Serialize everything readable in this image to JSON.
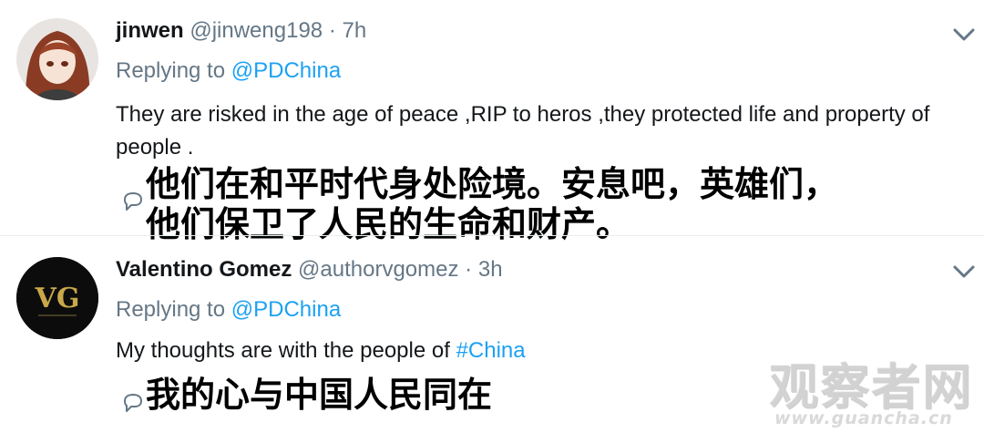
{
  "tweets": [
    {
      "name": "jinwen",
      "handle": "@jinweng198",
      "dot": "·",
      "time": "7h",
      "replying_label": "Replying to",
      "replying_to": "@PDChina",
      "text": "They are risked in the age of peace ,RIP to heros ,they protected life and property of people .",
      "caption_lines": [
        "他们在和平时代身处险境。安息吧，英雄们，",
        "他们保卫了人民的生命和财产。"
      ]
    },
    {
      "name": "Valentino Gomez",
      "handle": "@authorvgomez",
      "dot": "·",
      "time": "3h",
      "replying_label": "Replying to",
      "replying_to": "@PDChina",
      "text_before": "My thoughts are with the people of ",
      "hashtag": "#China",
      "caption_lines": [
        "我的心与中国人民同在"
      ],
      "avatar_monogram": "VG"
    }
  ],
  "watermark": {
    "text": "观察者网",
    "url": "www.guancha.cn"
  },
  "colors": {
    "link": "#1da1f2",
    "secondary": "#657786",
    "divider": "#e6ecf0"
  },
  "icons": [
    "chevron-down-icon",
    "reply-icon"
  ]
}
